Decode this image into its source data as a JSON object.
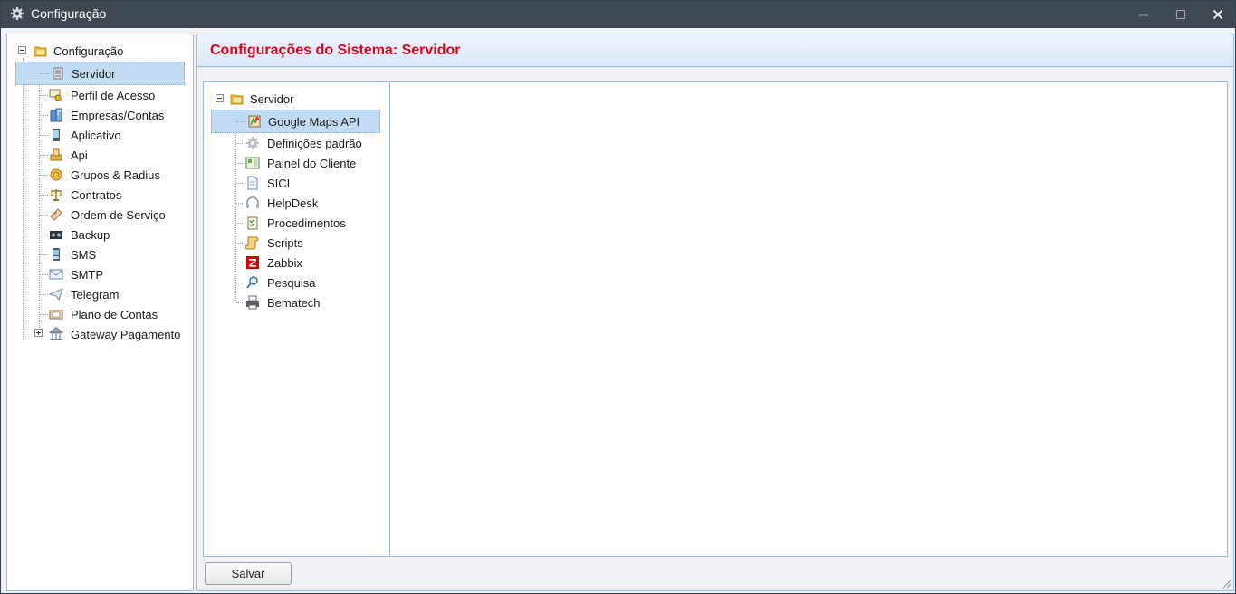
{
  "window": {
    "title": "Configuração",
    "controls": {
      "minimize": "—",
      "maximize": "☐",
      "close": "✕"
    }
  },
  "sidebar": {
    "root": {
      "label": "Configuração",
      "icon": "folder-icon"
    },
    "items": [
      {
        "label": "Servidor",
        "icon": "server-icon",
        "selected": true
      },
      {
        "label": "Perfil de Acesso",
        "icon": "key-icon"
      },
      {
        "label": "Empresas/Contas",
        "icon": "building-icon"
      },
      {
        "label": "Aplicativo",
        "icon": "mobile-icon"
      },
      {
        "label": "Api",
        "icon": "api-icon"
      },
      {
        "label": "Grupos & Radius",
        "icon": "coins-icon"
      },
      {
        "label": "Contratos",
        "icon": "scale-icon"
      },
      {
        "label": "Ordem de Serviço",
        "icon": "ticket-icon"
      },
      {
        "label": "Backup",
        "icon": "tape-icon"
      },
      {
        "label": "SMS",
        "icon": "phone-icon"
      },
      {
        "label": "SMTP",
        "icon": "mail-icon"
      },
      {
        "label": "Telegram",
        "icon": "paper-plane-icon"
      },
      {
        "label": "Plano de Contas",
        "icon": "ledger-icon"
      },
      {
        "label": "Gateway Pagamento",
        "icon": "bank-icon",
        "collapsed": true
      }
    ]
  },
  "main": {
    "header": "Configurações do Sistema: Servidor",
    "tree": {
      "root": {
        "label": "Servidor",
        "icon": "folder-icon"
      },
      "items": [
        {
          "label": "Google Maps API",
          "icon": "map-icon",
          "selected": true
        },
        {
          "label": "Definições padrão",
          "icon": "cog-icon"
        },
        {
          "label": "Painel do Cliente",
          "icon": "panel-icon"
        },
        {
          "label": "SICI",
          "icon": "document-icon"
        },
        {
          "label": "HelpDesk",
          "icon": "headset-icon"
        },
        {
          "label": "Procedimentos",
          "icon": "checklist-icon"
        },
        {
          "label": "Scripts",
          "icon": "scroll-icon"
        },
        {
          "label": "Zabbix",
          "icon": "zabbix-icon"
        },
        {
          "label": "Pesquisa",
          "icon": "magnifier-icon"
        },
        {
          "label": "Bematech",
          "icon": "printer-icon"
        }
      ]
    },
    "save_label": "Salvar"
  },
  "colors": {
    "titlebar": "#3d4852",
    "header_text": "#e3001b",
    "border": "#99bbe8",
    "selection": "#c3dcf6"
  }
}
